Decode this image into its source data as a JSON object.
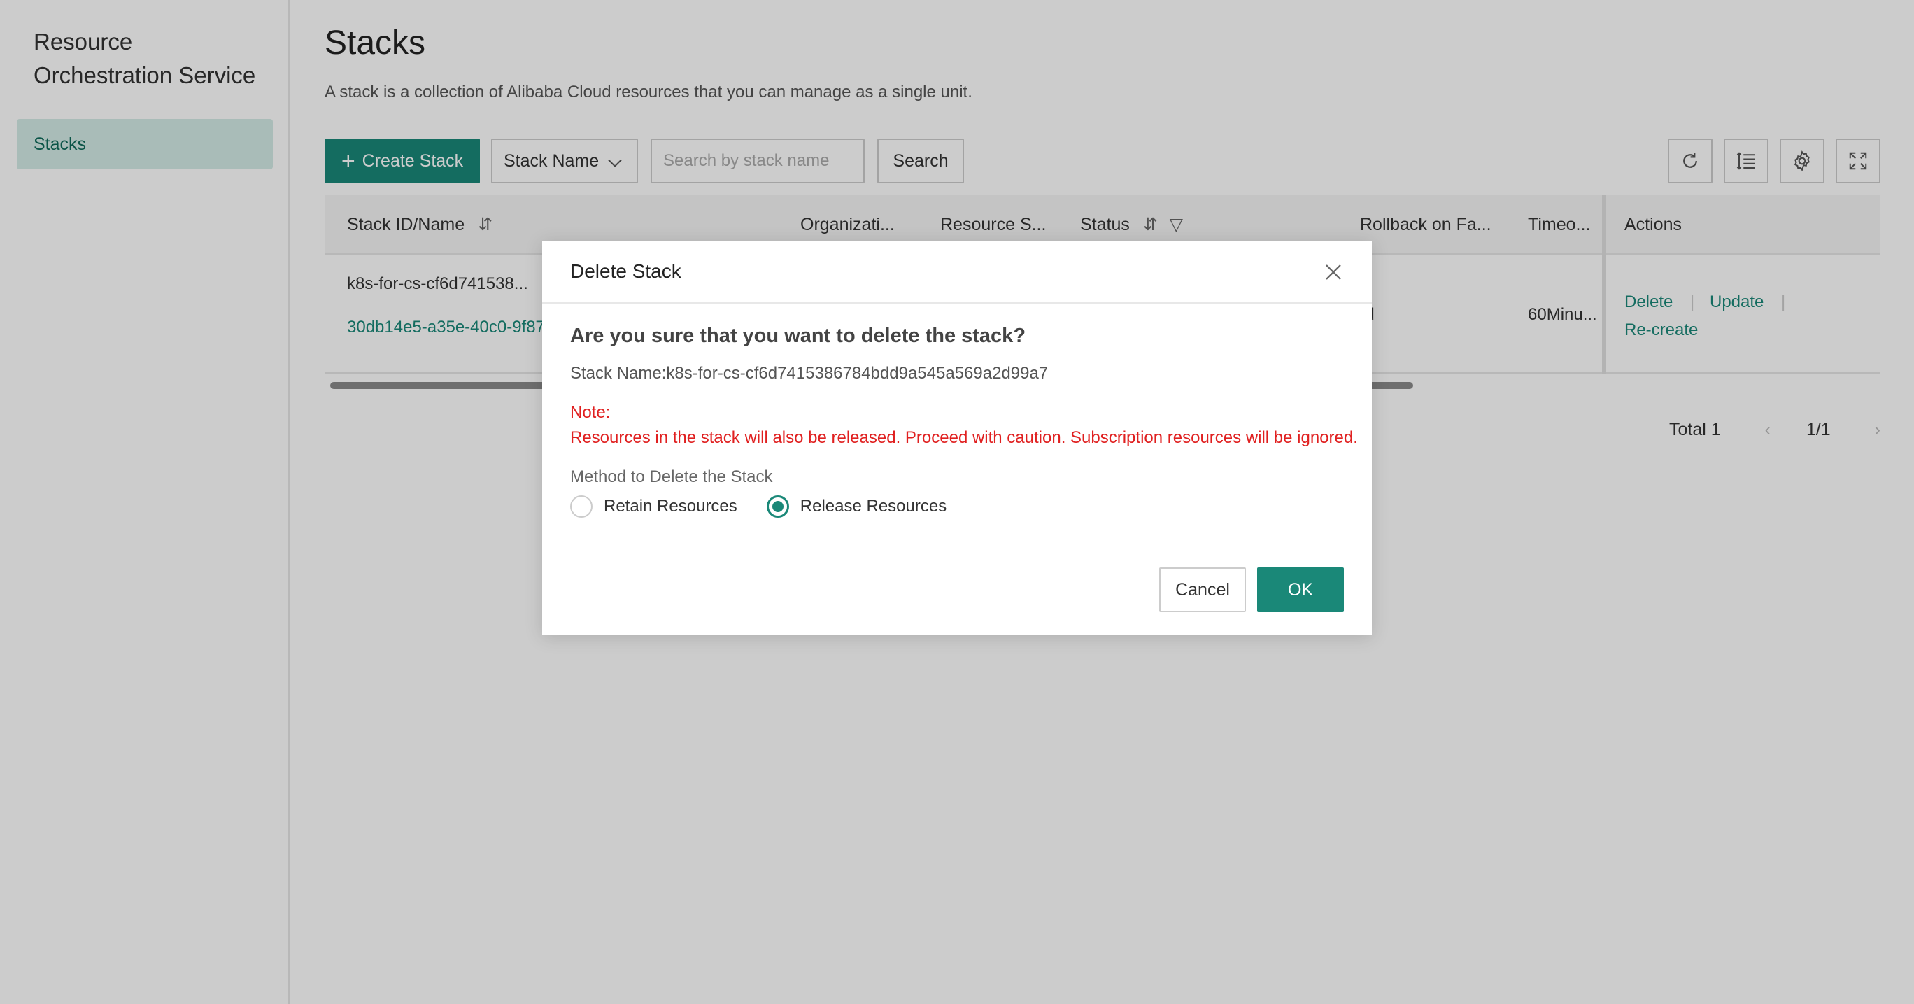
{
  "sidebar": {
    "product_name": "Resource Orchestration Service",
    "items": [
      {
        "label": "Stacks",
        "active": true
      }
    ]
  },
  "header": {
    "title": "Stacks",
    "description": "A stack is a collection of Alibaba Cloud resources that you can manage as a single unit."
  },
  "toolbar": {
    "create_label": "Create Stack",
    "filter_select_value": "Stack Name",
    "search_placeholder": "Search by stack name",
    "search_label": "Search",
    "icons": [
      "refresh-icon",
      "column-settings-icon",
      "gear-icon",
      "fullscreen-icon"
    ]
  },
  "table": {
    "columns": {
      "id_name": "Stack ID/Name",
      "organization": "Organizati...",
      "resource_status": "Resource S...",
      "status": "Status",
      "rollback": "Rollback on Fa...",
      "timeout": "Timeo...",
      "actions": "Actions"
    },
    "rows": [
      {
        "name": "k8s-for-cs-cf6d741538...",
        "id": "30db14e5-a35e-40c0-9f87",
        "rollback": "ed",
        "timeout": "60Minu...",
        "actions": {
          "delete": "Delete",
          "update": "Update",
          "recreate": "Re-create"
        }
      }
    ]
  },
  "pagination": {
    "total": "Total 1",
    "page": "1/1"
  },
  "modal": {
    "title": "Delete Stack",
    "question": "Are you sure that you want to delete the stack?",
    "stack_name": "Stack Name:k8s-for-cs-cf6d7415386784bdd9a545a569a2d99a7",
    "note_label": "Note:",
    "note_text": "Resources in the stack will also be released. Proceed with caution. Subscription resources will be ignored.",
    "method_label": "Method to Delete the Stack",
    "options": [
      {
        "label": "Retain Resources",
        "checked": false
      },
      {
        "label": "Release Resources",
        "checked": true
      }
    ],
    "cancel_label": "Cancel",
    "ok_label": "OK"
  },
  "colors": {
    "accent": "#1a8878",
    "danger": "#e02020",
    "overlay": "rgba(0,0,0,0.2)"
  }
}
